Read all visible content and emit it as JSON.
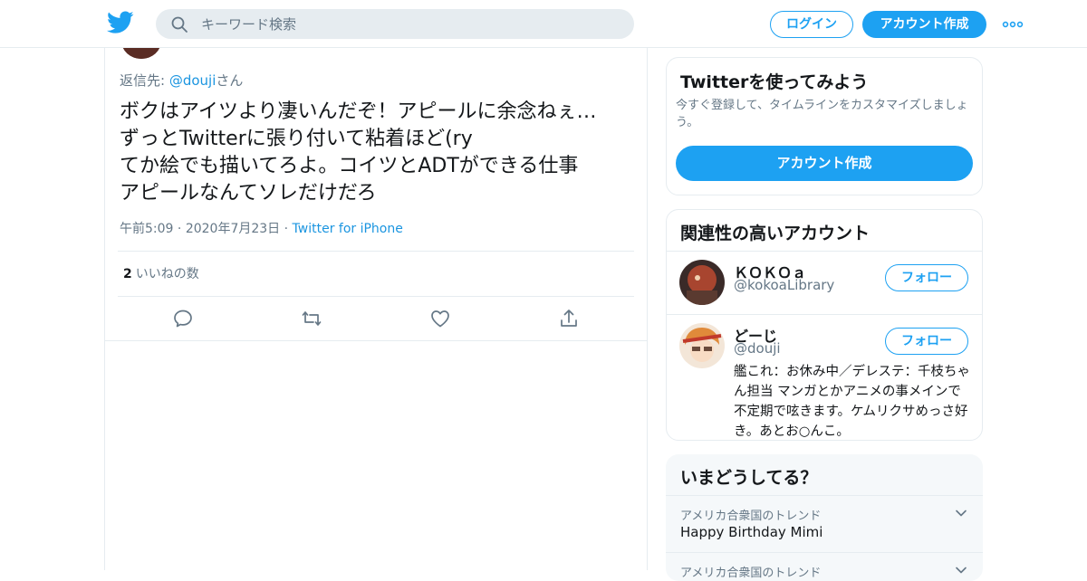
{
  "header": {
    "logo": "twitter-bird-icon",
    "search_placeholder": "キーワード検索",
    "login_label": "ログイン",
    "signup_label": "アカウント作成"
  },
  "tweet": {
    "reply_prefix": "返信先: ",
    "reply_mention": "@douji",
    "reply_suffix": "さん",
    "lines": [
      "ボクはアイツより凄いんだぞ！アピールに余念ねぇ…",
      "ずっとTwitterに張り付いて粘着ほど(ry",
      "てか絵でも描いてろよ。コイツとADTができる仕事",
      "アピールなんてソレだけだろ"
    ],
    "time": "午前5:09",
    "date": "2020年7月23日",
    "source": "Twitter for iPhone",
    "like_count": "2",
    "like_label": "いいねの数"
  },
  "signup_card": {
    "title": "Twitterを使ってみよう",
    "desc": "今すぐ登録して、タイムラインをカスタマイズしましょう。",
    "button": "アカウント作成"
  },
  "accounts_card": {
    "title": "関連性の高いアカウント",
    "accounts": [
      {
        "name": "ＫＯＫＯａ",
        "handle": "@kokoaLibrary",
        "follow": "フォロー"
      },
      {
        "name": "どーじ",
        "handle": "@douji",
        "follow": "フォロー",
        "bio": "艦これ：お休み中／デレステ：千枝ちゃん担当 マンガとかアニメの事メインで不定期で呟きます。ケムリクサめっさ好き。あとお○んこ。"
      }
    ]
  },
  "trends_card": {
    "title": "いまどうしてる？",
    "items": [
      {
        "context": "アメリカ合衆国のトレンド",
        "name": "Happy Birthday Mimi"
      },
      {
        "context": "アメリカ合衆国のトレンド"
      }
    ]
  },
  "colors": {
    "accent": "#1da1f2",
    "link": "#1b95e0",
    "muted": "#657786",
    "border": "#e6ecf0"
  }
}
